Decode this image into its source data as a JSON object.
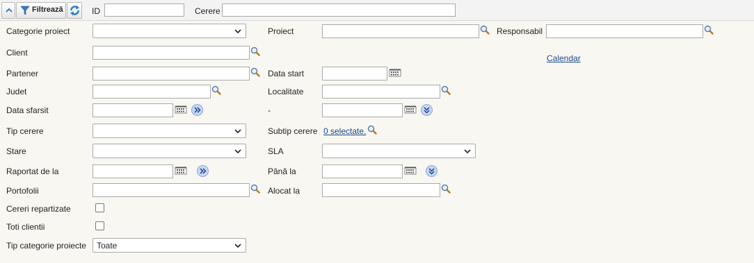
{
  "toolbar": {
    "filter_label": "Filtrează",
    "id_label": "ID",
    "cerere_label": "Cerere"
  },
  "form": {
    "categorie_proiect_label": "Categorie proiect",
    "proiect_label": "Proiect",
    "responsabil_label": "Responsabil",
    "client_label": "Client",
    "calendar_link": "Calendar",
    "partener_label": "Partener",
    "data_start_label": "Data start",
    "judet_label": "Judet",
    "localitate_label": "Localitate",
    "data_sfarsit_label": "Data sfarsit",
    "dash_label": "-",
    "tip_cerere_label": "Tip cerere",
    "subtip_cerere_label": "Subtip cerere",
    "subtip_selected": "0 selectate.",
    "stare_label": "Stare",
    "sla_label": "SLA",
    "raportat_de_la_label": "Raportat de la",
    "pana_la_label": "Până la",
    "portofolii_label": "Portofolii",
    "alocat_la_label": "Alocat la",
    "cereri_repartizate_label": "Cereri repartizate",
    "toti_clientii_label": "Toti clientii",
    "tip_categorie_proiecte_label": "Tip categorie proiecte",
    "tip_categorie_proiecte_value": "Toate"
  },
  "icons": {
    "collapse": "chevron-up-icon",
    "filter": "funnel-icon",
    "refresh": "refresh-icon",
    "search": "magnifier-icon",
    "calendar": "calendar-icon",
    "forward": "double-chevron-right-icon",
    "expand": "double-chevron-down-icon"
  },
  "colors": {
    "page_background": "#f8f7f1",
    "link": "#1a4a8a",
    "accent_blue": "#3a78c9"
  }
}
